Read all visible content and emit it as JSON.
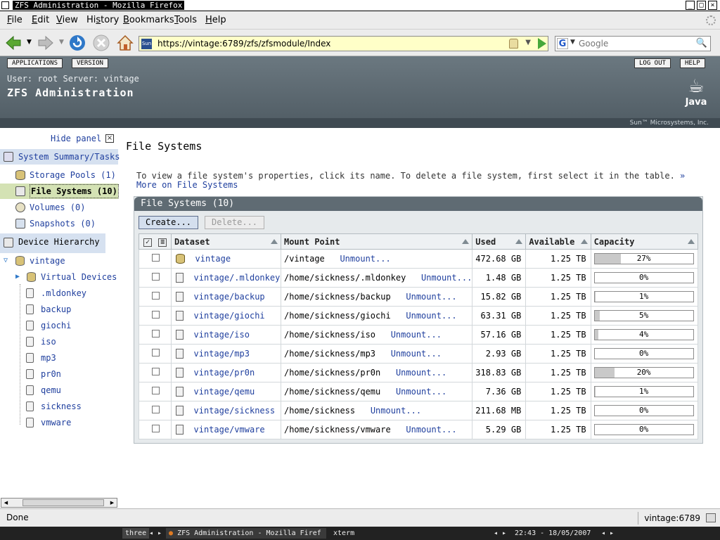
{
  "window": {
    "title": "ZFS Administration - Mozilla Firefox",
    "buttons": [
      "_",
      "□",
      "×"
    ]
  },
  "menu": [
    "File",
    "Edit",
    "View",
    "History",
    "Bookmarks",
    "Tools",
    "Help"
  ],
  "navbar": {
    "url": "https://vintage:6789/zfs/zfsmodule/Index",
    "site_icon_text": "Sun",
    "search_placeholder": "Google"
  },
  "masthead": {
    "buttons_left": [
      "APPLICATIONS",
      "VERSION"
    ],
    "buttons_right": [
      "LOG OUT",
      "HELP"
    ],
    "user_info": "User: root   Server: vintage",
    "title": "ZFS Administration",
    "java_label": "Java",
    "sun_label": "Sun™ Microsystems, Inc."
  },
  "leftpanel": {
    "hide_panel": "Hide panel",
    "system_summary": "System Summary/Tasks",
    "storage_pools": "Storage Pools (1)",
    "file_systems": "File Systems (10)",
    "volumes": "Volumes (0)",
    "snapshots": "Snapshots (0)",
    "device_hierarchy": "Device Hierarchy",
    "pool_name": "vintage",
    "virtual_devices": "Virtual Devices",
    "datasets": [
      ".mldonkey",
      "backup",
      "giochi",
      "iso",
      "mp3",
      "pr0n",
      "qemu",
      "sickness",
      "vmware"
    ]
  },
  "content": {
    "heading": "File Systems",
    "help_text": "To view a file system's properties, click its name. To delete a file system, first select it in the table.",
    "help_link": "» More on File Systems",
    "table_title": "File Systems (10)",
    "create_button": "Create...",
    "delete_button": "Delete...",
    "columns": [
      "Dataset",
      "Mount Point",
      "Used",
      "Available",
      "Capacity"
    ],
    "unmount_label": "Unmount...",
    "rows": [
      {
        "dataset": "vintage",
        "mount": "/vintage",
        "used": "472.68 GB",
        "available": "1.25 TB",
        "capacity": "27%",
        "pct": 27,
        "pool": true
      },
      {
        "dataset": "vintage/.mldonkey",
        "mount": "/home/sickness/.mldonkey",
        "used": "1.48 GB",
        "available": "1.25 TB",
        "capacity": "0%",
        "pct": 0
      },
      {
        "dataset": "vintage/backup",
        "mount": "/home/sickness/backup",
        "used": "15.82 GB",
        "available": "1.25 TB",
        "capacity": "1%",
        "pct": 1
      },
      {
        "dataset": "vintage/giochi",
        "mount": "/home/sickness/giochi",
        "used": "63.31 GB",
        "available": "1.25 TB",
        "capacity": "5%",
        "pct": 5
      },
      {
        "dataset": "vintage/iso",
        "mount": "/home/sickness/iso",
        "used": "57.16 GB",
        "available": "1.25 TB",
        "capacity": "4%",
        "pct": 4
      },
      {
        "dataset": "vintage/mp3",
        "mount": "/home/sickness/mp3",
        "used": "2.93 GB",
        "available": "1.25 TB",
        "capacity": "0%",
        "pct": 0
      },
      {
        "dataset": "vintage/pr0n",
        "mount": "/home/sickness/pr0n",
        "used": "318.83 GB",
        "available": "1.25 TB",
        "capacity": "20%",
        "pct": 20
      },
      {
        "dataset": "vintage/qemu",
        "mount": "/home/sickness/qemu",
        "used": "7.36 GB",
        "available": "1.25 TB",
        "capacity": "1%",
        "pct": 1
      },
      {
        "dataset": "vintage/sickness",
        "mount": "/home/sickness",
        "used": "211.68 MB",
        "available": "1.25 TB",
        "capacity": "0%",
        "pct": 0
      },
      {
        "dataset": "vintage/vmware",
        "mount": "/home/sickness/vmware",
        "used": "5.29 GB",
        "available": "1.25 TB",
        "capacity": "0%",
        "pct": 0
      }
    ]
  },
  "status": {
    "text": "Done",
    "host": "vintage:6789"
  },
  "taskbar": {
    "desktop": "three",
    "task_firefox": "ZFS Administration - Mozilla Firef",
    "task_xterm": "xterm",
    "clock": "22:43 - 18/05/2007"
  },
  "colors": {
    "link": "#1f3f9e",
    "masthead": "#5b6770",
    "selected_nav": "#d4e2b4"
  }
}
